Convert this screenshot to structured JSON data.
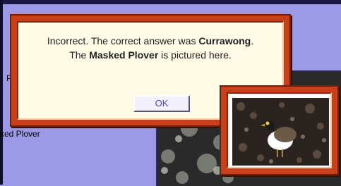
{
  "background": {
    "label_partial_r": "P",
    "label_partial_name": "ked Plover"
  },
  "dialog": {
    "line1_prefix": "Incorrect. The correct answer was ",
    "correct_answer": "Currawong",
    "line1_suffix": ".",
    "line2_prefix": "The ",
    "pictured_bird": "Masked Plover",
    "line2_suffix": " is pictured here.",
    "ok_label": "OK"
  },
  "colors": {
    "frame": "#c8401b",
    "background": "#9c9ae6",
    "button_text": "#4c44c0"
  }
}
